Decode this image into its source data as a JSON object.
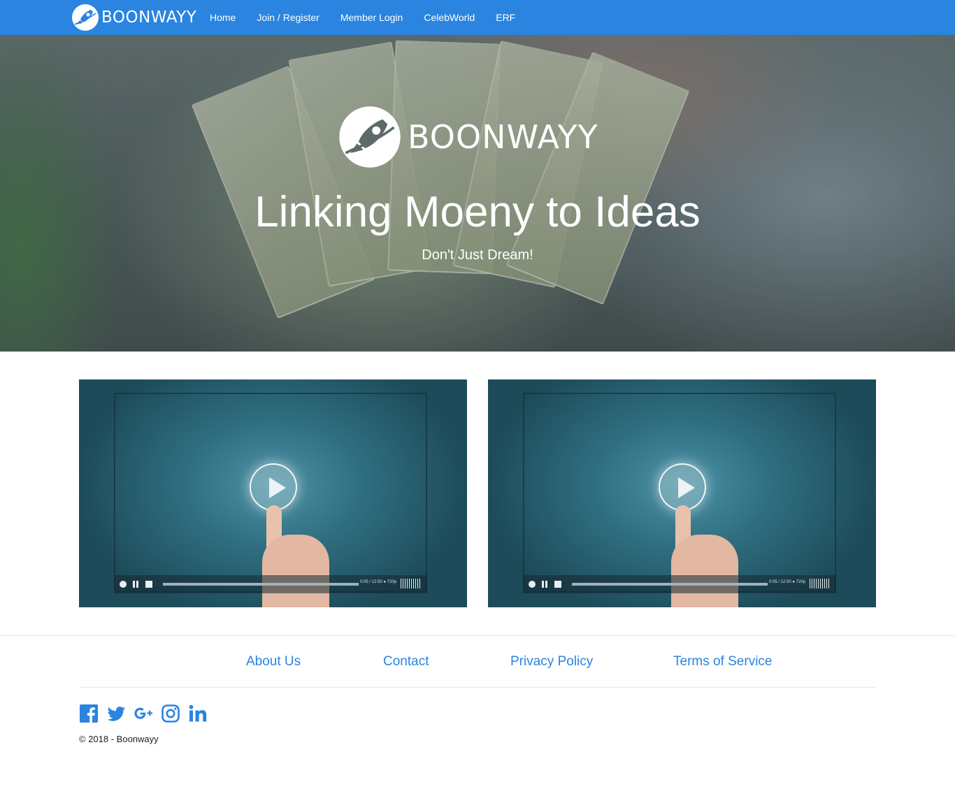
{
  "colors": {
    "primary": "#2a84e0",
    "white": "#ffffff",
    "text": "#222222"
  },
  "navbar": {
    "brand": "BOONWAYY",
    "brand_icon": "rocket-logo-icon",
    "links": [
      "Home",
      "Join / Register",
      "Member Login",
      "CelebWorld",
      "ERF"
    ]
  },
  "hero": {
    "logo_text": "BOONWAYY",
    "title": "Linking Moeny to Ideas",
    "subtitle": "Don't Just Dream!"
  },
  "videos": [
    {
      "icon": "play-icon",
      "time": "0:05 / 12:50  ● 720p"
    },
    {
      "icon": "play-icon",
      "time": "0:05 / 12:50  ● 720p"
    }
  ],
  "footer": {
    "links": [
      "About Us",
      "Contact",
      "Privacy Policy",
      "Terms of Service"
    ],
    "social": [
      "facebook-icon",
      "twitter-icon",
      "google-plus-icon",
      "instagram-icon",
      "linkedin-icon"
    ],
    "copyright": "© 2018 - Boonwayy"
  }
}
